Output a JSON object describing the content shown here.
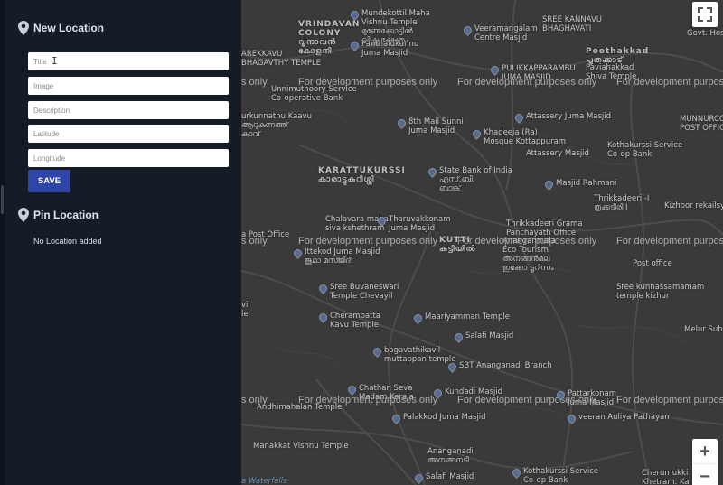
{
  "sidebar": {
    "new_location": {
      "title": "New Location",
      "fields": [
        {
          "placeholder": "Title"
        },
        {
          "placeholder": "Image"
        },
        {
          "placeholder": "Description"
        },
        {
          "placeholder": "Latitude"
        },
        {
          "placeholder": "Longitude"
        }
      ],
      "save_label": "SAVE"
    },
    "pin_location": {
      "title": "Pin Location",
      "empty_message": "No Location added"
    }
  },
  "map": {
    "watermark": "For development purposes only",
    "controls": {
      "fullscreen_icon": "fullscreen-icon",
      "zoom_in": "+",
      "zoom_out": "−"
    },
    "labels": [
      "VRINDAVAN\nCOLONY\nവൃന്ദാവൻ\nകോളനി",
      "Mundekottil Maha\nVishnu Temple\nമുണ്ടേക്കോട്ടിൽ\nവിഷ്ണു ക്ഷേത്രം",
      "Panthalukunnu\nJuma Masjid",
      "Veeramangalam\nCentre Masjid",
      "SREE KANNAVU\nBHAGHAVATI",
      "Govt. Hos",
      "AREKKAVU\nBHAGAVTHY TEMPLE",
      "Poothakkad\nപൂതക്കാട്",
      "PULIKKAPPARAMBU\nJUMA MASJID",
      "Paviahakkad\nShiva Temple",
      "Unnimuthoory Service\nCo-operative Bank",
      "urkunnathu Kaavu\nആറുകുന്നത്ത്\nകാവ്",
      "8th Mail Sunni\nJuma Masjid",
      "Attassery Juma Masjid",
      "Khadeeja (Ra)\nMosque Kottappuram",
      "MUNNURCODE\nPOST OFFICE",
      "Kothakurssi Service\nCo-op Bank",
      "Attassery Masjid",
      "KARATTUKURSSI\nകാരാട്ടുകുറിശ്ശി",
      "State Bank of India\nഎസ്.ബി.\nബാങ്ക്",
      "Masjid Rahmani",
      "Thrikkadeeri -I\nതൃക്കടീരി I",
      "Kizhoor rekailsy",
      "Chalavara maha\nsiva kshethram",
      "Tharuvakkonam\nJuma Masjid",
      "Thrikkadeeri Grama\nPanchayath Office",
      "a Post Office",
      "Ittekod Juma Masjid\nജുമാ മസ്ജിദ്",
      "KUTTI\nകുട്ടിയിൽ",
      "Ananganmala\nEco Tourism\nഅനങ്ങൻമല\nഇക്കോ ടൂറിസം",
      "Post office",
      "Sree Buvaneswari\nTemple Chevayil",
      "Sree kunnassamamam\ntemple kizhur",
      "vil\nle",
      "Cherambatta\nKavu Temple",
      "Maariyamman Temple",
      "Melur Sub",
      "Salafi Masjid",
      "bagavathikavil\nmuttappan temple",
      "SBT Ananganadi Branch",
      "Chathan Seva\nMadam Kerala",
      "Kundadi Masjid",
      "Pattarkonam\nJuma Masjid",
      "Andhimahalan Temple",
      "Palakkod Juma Masjid",
      "veeran Auliya Pathayam",
      "Manakkat Vishnu Temple",
      "Ananganadi\nഅനങ്ങനടി",
      "Kothakurssi Service\nCo-op Bank",
      "Cherumukki\nKhetram. Ka",
      "Salafi Masjid",
      "a Waterfalls"
    ]
  }
}
